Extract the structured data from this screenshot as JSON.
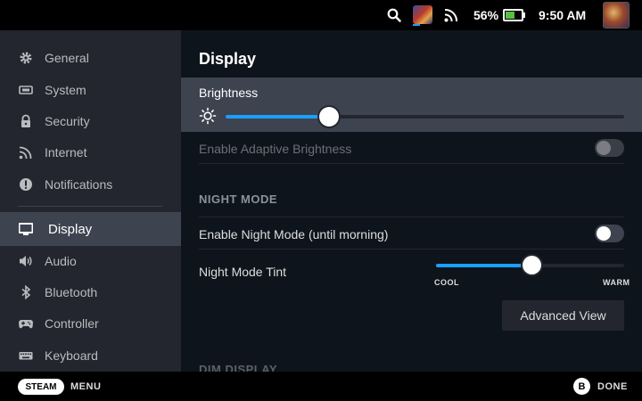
{
  "status_bar": {
    "battery_percent": "56%",
    "battery_level": 0.56,
    "time": "9:50 AM",
    "icons": [
      "search-icon",
      "game-thumbnail",
      "wifi-icon",
      "battery-icon",
      "avatar"
    ]
  },
  "sidebar": {
    "items": [
      {
        "label": "General",
        "icon": "gear-icon"
      },
      {
        "label": "System",
        "icon": "system-icon"
      },
      {
        "label": "Security",
        "icon": "lock-icon"
      },
      {
        "label": "Internet",
        "icon": "wifi-icon"
      },
      {
        "label": "Notifications",
        "icon": "info-icon"
      },
      {
        "label": "Display",
        "icon": "monitor-icon",
        "active": true
      },
      {
        "label": "Audio",
        "icon": "speaker-icon"
      },
      {
        "label": "Bluetooth",
        "icon": "bluetooth-icon"
      },
      {
        "label": "Controller",
        "icon": "gamepad-icon"
      },
      {
        "label": "Keyboard",
        "icon": "keyboard-icon"
      }
    ]
  },
  "main": {
    "title": "Display",
    "brightness": {
      "label": "Brightness",
      "value": 0.26
    },
    "adaptive_brightness": {
      "label": "Enable Adaptive Brightness",
      "enabled": false,
      "disabled": true
    },
    "night_mode_header": "NIGHT MODE",
    "night_mode_toggle": {
      "label": "Enable Night Mode (until morning)",
      "enabled": false
    },
    "night_mode_tint": {
      "label": "Night Mode Tint",
      "value": 0.51,
      "min_label": "COOL",
      "max_label": "WARM"
    },
    "advanced_view_label": "Advanced View",
    "next_section_header": "DIM DISPLAY"
  },
  "bottom_bar": {
    "steam_label": "STEAM",
    "menu_label": "MENU",
    "b_label": "B",
    "done_label": "DONE"
  },
  "colors": {
    "accent": "#1a9fff",
    "sidebar_bg": "#23262e",
    "active_bg": "#3d4450",
    "main_bg": "#0e141b",
    "battery_fill": "#59bf40"
  }
}
